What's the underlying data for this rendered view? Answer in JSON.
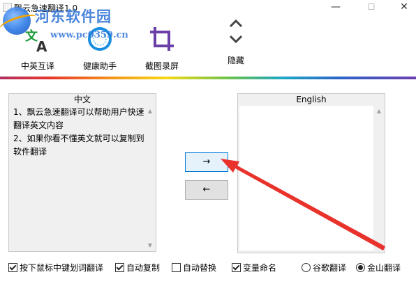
{
  "window": {
    "title": "飘云急速翻译1.0",
    "minimize_glyph": "—",
    "maximize_glyph": "☐",
    "close_glyph": "✕"
  },
  "watermark": {
    "title": "河东软件园",
    "url": "www.pc0359.cn"
  },
  "toolbar": {
    "items": [
      {
        "label": "中英互译",
        "icon": "translate-icon"
      },
      {
        "label": "健康助手",
        "icon": "health-ring-icon"
      },
      {
        "label": "截图录屏",
        "icon": "crop-icon"
      },
      {
        "label": "隐藏",
        "icon": "collapse-chevrons-icon"
      }
    ]
  },
  "panels": {
    "source": {
      "header": "中文",
      "text": "1、飘云急速翻译可以帮助用户快速翻译英文内容\n2、如果你看不懂英文就可以复制到软件翻译"
    },
    "target": {
      "header": "English",
      "text": ""
    }
  },
  "buttons": {
    "translate_label": "→",
    "reverse_label": "←"
  },
  "options": {
    "checkboxes": [
      {
        "label": "按下鼠标中键划词翻译",
        "checked": true
      },
      {
        "label": "自动复制",
        "checked": true
      },
      {
        "label": "自动替换",
        "checked": false
      },
      {
        "label": "变量命名",
        "checked": true
      }
    ],
    "engines": [
      {
        "label": "谷歌翻译",
        "selected": false
      },
      {
        "label": "金山翻译",
        "selected": true
      }
    ]
  },
  "colors": {
    "annotation_arrow": "#e8322b",
    "accent": "#0078d7",
    "crop_icon": "#6a3fa8",
    "health_icon": "#1a8fe0"
  }
}
